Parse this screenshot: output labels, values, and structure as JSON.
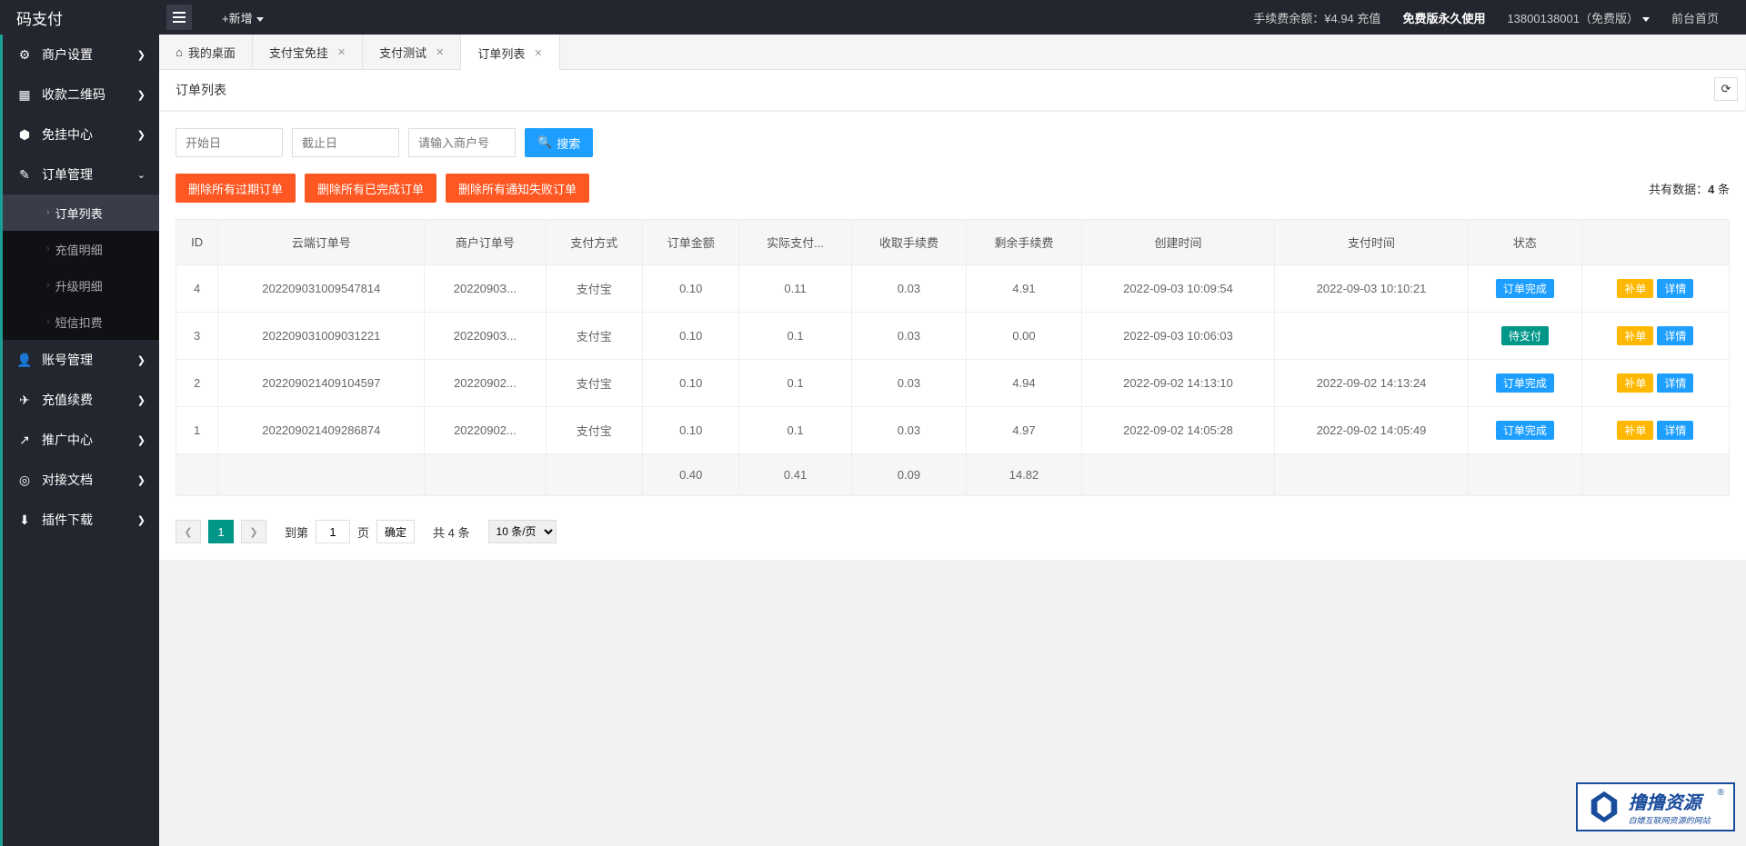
{
  "header": {
    "logo": "码支付",
    "add_new": "+新增",
    "fee_label": "手续费余额：",
    "fee_value": "¥4.94",
    "recharge": "充值",
    "free_version": "免费版永久使用",
    "account": "13800138001（免费版）",
    "frontend": "前台首页"
  },
  "sidebar": {
    "items": [
      {
        "icon": "⚙",
        "label": "商户设置",
        "arrow": "❯"
      },
      {
        "icon": "▦",
        "label": "收款二维码",
        "arrow": "❯"
      },
      {
        "icon": "⬢",
        "label": "免挂中心",
        "arrow": "❯"
      },
      {
        "icon": "✎",
        "label": "订单管理",
        "arrow": "⌄"
      },
      {
        "icon": "👤",
        "label": "账号管理",
        "arrow": "❯"
      },
      {
        "icon": "✈",
        "label": "充值续费",
        "arrow": "❯"
      },
      {
        "icon": "↗",
        "label": "推广中心",
        "arrow": "❯"
      },
      {
        "icon": "◎",
        "label": "对接文档",
        "arrow": "❯"
      },
      {
        "icon": "⬇",
        "label": "插件下载",
        "arrow": "❯"
      }
    ],
    "sub_order": [
      {
        "label": "订单列表",
        "active": true
      },
      {
        "label": "充值明细",
        "active": false
      },
      {
        "label": "升级明细",
        "active": false
      },
      {
        "label": "短信扣费",
        "active": false
      }
    ]
  },
  "tabs": [
    {
      "label": "我的桌面",
      "home": true,
      "closable": false
    },
    {
      "label": "支付宝免挂",
      "closable": true
    },
    {
      "label": "支付测试",
      "closable": true
    },
    {
      "label": "订单列表",
      "closable": true,
      "active": true
    }
  ],
  "panel": {
    "title": "订单列表"
  },
  "filters": {
    "start_ph": "开始日",
    "end_ph": "截止日",
    "merchant_ph": "请输入商户号",
    "search_btn": "搜索"
  },
  "actions": {
    "del_expired": "删除所有过期订单",
    "del_completed": "删除所有已完成订单",
    "del_failed": "删除所有通知失败订单",
    "total_prefix": "共有数据：",
    "total_count": "4",
    "total_suffix": " 条"
  },
  "table": {
    "headers": [
      "ID",
      "云端订单号",
      "商户订单号",
      "支付方式",
      "订单金额",
      "实际支付...",
      "收取手续费",
      "剩余手续费",
      "创建时间",
      "支付时间",
      "状态",
      ""
    ],
    "rows": [
      {
        "id": "4",
        "cloud": "202209031009547814",
        "mer": "2022090З...",
        "pay": "支付宝",
        "amt": "0.10",
        "real": "0.11",
        "fee": "0.03",
        "remain": "4.91",
        "ctime": "2022-09-03 10:09:54",
        "ptime": "2022-09-03 10:10:21",
        "status": "订单完成",
        "status_cls": "badge-blue"
      },
      {
        "id": "3",
        "cloud": "202209031009031221",
        "mer": "2022090З...",
        "pay": "支付宝",
        "amt": "0.10",
        "real": "0.1",
        "fee": "0.03",
        "remain": "0.00",
        "ctime": "2022-09-03 10:06:03",
        "ptime": "",
        "status": "待支付",
        "status_cls": "badge-teal"
      },
      {
        "id": "2",
        "cloud": "202209021409104597",
        "mer": "20220902...",
        "pay": "支付宝",
        "amt": "0.10",
        "real": "0.1",
        "fee": "0.03",
        "remain": "4.94",
        "ctime": "2022-09-02 14:13:10",
        "ptime": "2022-09-02 14:13:24",
        "status": "订单完成",
        "status_cls": "badge-blue"
      },
      {
        "id": "1",
        "cloud": "202209021409286874",
        "mer": "20220902...",
        "pay": "支付宝",
        "amt": "0.10",
        "real": "0.1",
        "fee": "0.03",
        "remain": "4.97",
        "ctime": "2022-09-02 14:05:28",
        "ptime": "2022-09-02 14:05:49",
        "status": "订单完成",
        "status_cls": "badge-blue"
      }
    ],
    "footer": {
      "amt": "0.40",
      "real": "0.41",
      "fee": "0.09",
      "remain": "14.82"
    },
    "op_supplement": "补单",
    "op_detail": "详情"
  },
  "pager": {
    "current": "1",
    "goto_label": "到第",
    "goto_value": "1",
    "page_label": "页",
    "confirm": "确定",
    "total": "共 4 条",
    "pagesize": "10 条/页"
  },
  "watermark": {
    "title": "撸撸资源",
    "sub": "白嫖互联网资源的网站"
  }
}
